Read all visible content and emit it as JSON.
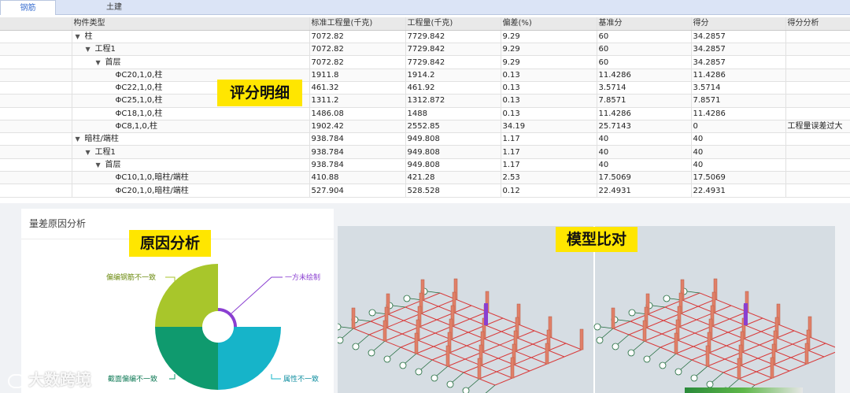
{
  "tabs": [
    {
      "label": "钢筋",
      "active": true
    },
    {
      "label": "土建",
      "active": false
    }
  ],
  "table": {
    "headers": [
      "构件类型",
      "标准工程量(千克)",
      "工程量(千克)",
      "偏差(%)",
      "基准分",
      "得分",
      "得分分析"
    ],
    "rows": [
      {
        "level": 0,
        "expand": "▼",
        "name": "柱",
        "std": "7072.82",
        "qty": "7729.842",
        "dev": "9.29",
        "base": "60",
        "score": "34.2857",
        "analysis": ""
      },
      {
        "level": 1,
        "expand": "▼",
        "name": "工程1",
        "std": "7072.82",
        "qty": "7729.842",
        "dev": "9.29",
        "base": "60",
        "score": "34.2857",
        "analysis": ""
      },
      {
        "level": 2,
        "expand": "▼",
        "name": "首层",
        "std": "7072.82",
        "qty": "7729.842",
        "dev": "9.29",
        "base": "60",
        "score": "34.2857",
        "analysis": ""
      },
      {
        "level": 3,
        "expand": "",
        "name": "ΦC20,1,0,柱",
        "std": "1911.8",
        "qty": "1914.2",
        "dev": "0.13",
        "base": "11.4286",
        "score": "11.4286",
        "analysis": ""
      },
      {
        "level": 3,
        "expand": "",
        "name": "ΦC22,1,0,柱",
        "std": "461.32",
        "qty": "461.92",
        "dev": "0.13",
        "base": "3.5714",
        "score": "3.5714",
        "analysis": ""
      },
      {
        "level": 3,
        "expand": "",
        "name": "ΦC25,1,0,柱",
        "std": "1311.2",
        "qty": "1312.872",
        "dev": "0.13",
        "base": "7.8571",
        "score": "7.8571",
        "analysis": ""
      },
      {
        "level": 3,
        "expand": "",
        "name": "ΦC18,1,0,柱",
        "std": "1486.08",
        "qty": "1488",
        "dev": "0.13",
        "base": "11.4286",
        "score": "11.4286",
        "analysis": ""
      },
      {
        "level": 3,
        "expand": "",
        "name": "ΦC8,1,0,柱",
        "std": "1902.42",
        "qty": "2552.85",
        "dev": "34.19",
        "base": "25.7143",
        "score": "0",
        "analysis": "工程量误差过大"
      },
      {
        "level": 0,
        "expand": "▼",
        "name": "暗柱/端柱",
        "std": "938.784",
        "qty": "949.808",
        "dev": "1.17",
        "base": "40",
        "score": "40",
        "analysis": ""
      },
      {
        "level": 1,
        "expand": "▼",
        "name": "工程1",
        "std": "938.784",
        "qty": "949.808",
        "dev": "1.17",
        "base": "40",
        "score": "40",
        "analysis": ""
      },
      {
        "level": 2,
        "expand": "▼",
        "name": "首层",
        "std": "938.784",
        "qty": "949.808",
        "dev": "1.17",
        "base": "40",
        "score": "40",
        "analysis": ""
      },
      {
        "level": 3,
        "expand": "",
        "name": "ΦC10,1,0,暗柱/端柱",
        "std": "410.88",
        "qty": "421.28",
        "dev": "2.53",
        "base": "17.5069",
        "score": "17.5069",
        "analysis": ""
      },
      {
        "level": 3,
        "expand": "",
        "name": "ΦC20,1,0,暗柱/端柱",
        "std": "527.904",
        "qty": "528.528",
        "dev": "0.12",
        "base": "22.4931",
        "score": "22.4931",
        "analysis": ""
      }
    ]
  },
  "annotations": {
    "score_detail": "评分明细",
    "cause_analysis": "原因分析",
    "model_compare": "模型比对"
  },
  "cause_panel": {
    "title": "量差原因分析",
    "slices": [
      {
        "label": "偏编钢筋不一致",
        "color": "#a8c62b"
      },
      {
        "label": "一方未绘制",
        "color": "#8a3fd1"
      },
      {
        "label": "属性不一致",
        "color": "#16b4c9"
      },
      {
        "label": "截面偏编不一致",
        "color": "#0f9a6e"
      }
    ]
  },
  "model_panel": {
    "background": "#d6dde3"
  },
  "watermark": "大数跨境",
  "colors": {
    "tab_active_text": "#3a6fd0",
    "annotation_bg": "#ffe600",
    "column_color": "#e08068",
    "highlight_column": "#8a3fd1",
    "grid_line": "#d83a3a",
    "axis_line": "#1e6a3a"
  }
}
